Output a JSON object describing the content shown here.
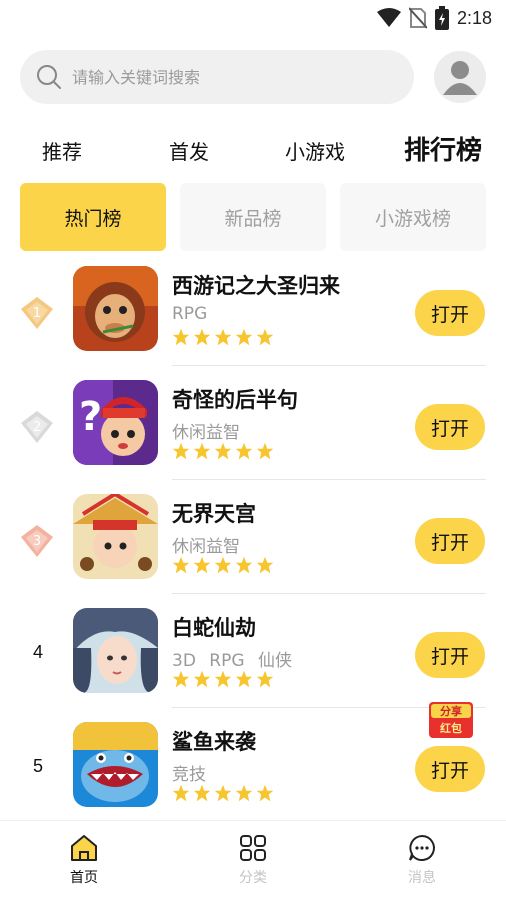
{
  "status_bar": {
    "time": "2:18",
    "icons": [
      "wifi-icon",
      "no-sim-icon",
      "battery-icon"
    ]
  },
  "search": {
    "placeholder": "请输入关键词搜索"
  },
  "top_tabs": [
    {
      "label": "推荐",
      "active": false
    },
    {
      "label": "首发",
      "active": false
    },
    {
      "label": "小游戏",
      "active": false
    },
    {
      "label": "排行榜",
      "active": true
    }
  ],
  "segments": [
    {
      "label": "热门榜",
      "active": true
    },
    {
      "label": "新品榜",
      "active": false
    },
    {
      "label": "小游戏榜",
      "active": false
    }
  ],
  "rank_badge_numbers": [
    "1",
    "2",
    "3"
  ],
  "games": [
    {
      "rank": "1",
      "name": "西游记之大圣归来",
      "tags": "RPG",
      "stars": 5,
      "button": "打开"
    },
    {
      "rank": "2",
      "name": "奇怪的后半句",
      "tags": "休闲益智",
      "stars": 5,
      "button": "打开"
    },
    {
      "rank": "3",
      "name": "无界天宫",
      "tags": "休闲益智",
      "stars": 5,
      "button": "打开"
    },
    {
      "rank": "4",
      "name": "白蛇仙劫",
      "tags": "3D RPG 仙侠",
      "stars": 5,
      "button": "打开"
    },
    {
      "rank": "5",
      "name": "鲨鱼来袭",
      "tags": "竞技",
      "stars": 5,
      "button": "打开"
    }
  ],
  "red_packet": {
    "line1": "分享",
    "line2": "红包"
  },
  "bottom_nav": [
    {
      "label": "首页",
      "icon": "home-icon",
      "active": true
    },
    {
      "label": "分类",
      "icon": "grid-icon",
      "active": false
    },
    {
      "label": "消息",
      "icon": "chat-icon",
      "active": false
    }
  ],
  "colors": {
    "accent": "#fcd44a",
    "star": "#f7c52e",
    "muted": "#9a9a9a",
    "gold": "#f5c882",
    "silver": "#d9d9d9",
    "bronze": "#f2b3a0"
  }
}
